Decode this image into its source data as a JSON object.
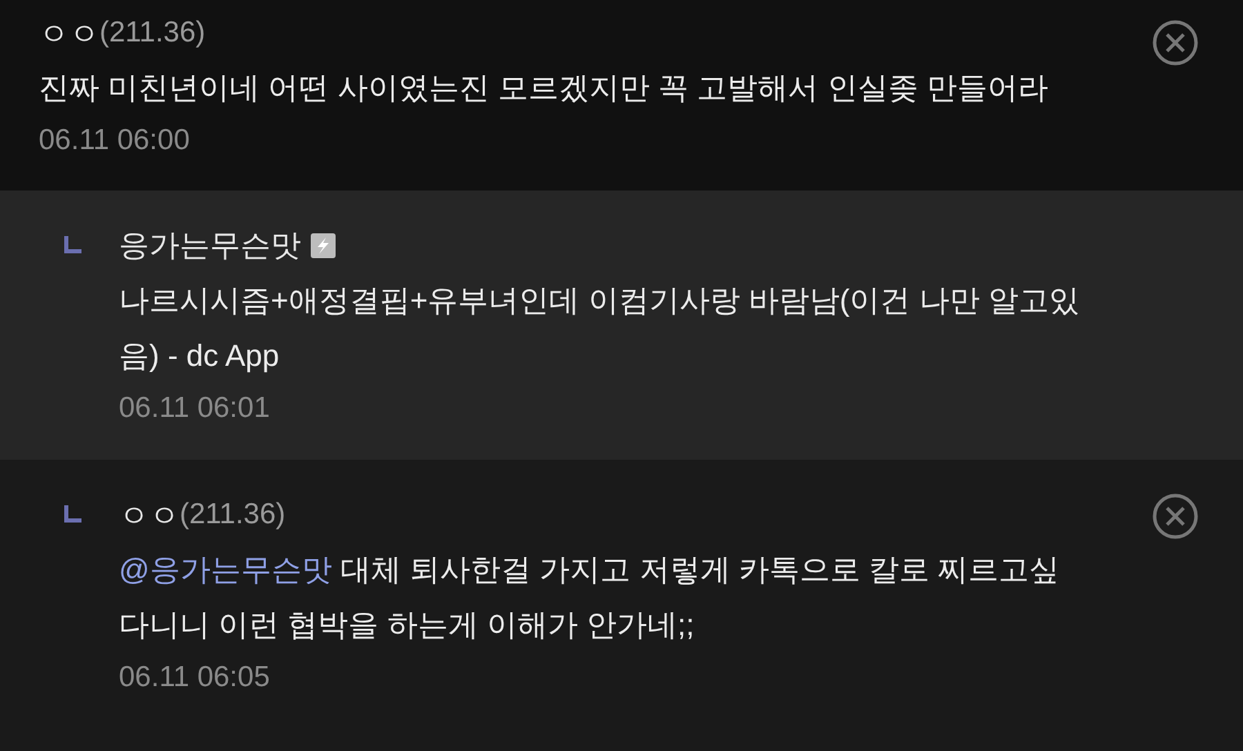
{
  "comments": [
    {
      "kind": "comment",
      "author": "ㅇㅇ",
      "ip": "(211.36)",
      "badge": false,
      "text": "진짜 미친년이네 어떤 사이였는진 모르겠지만 꼭 고발해서 인실좆 만들어라",
      "time": "06.11 06:00",
      "deletable": true
    },
    {
      "kind": "reply",
      "author": "응가는무슨맛",
      "badge": true,
      "text": "나르시시즘+애정결핍+유부녀인데 이컴기사랑 바람남(이건 나만 알고있음) - dc App",
      "time": "06.11 06:01",
      "deletable": false
    },
    {
      "kind": "reply",
      "author": "ㅇㅇ",
      "ip": "(211.36)",
      "badge": false,
      "mention": "@응가는무슨맛",
      "text": "대체 퇴사한걸 가지고 저렇게 카톡으로 칼로 찌르고싶다니니 이런 협박을 하는게 이해가 안가네;;",
      "time": "06.11 06:05",
      "deletable": true
    }
  ]
}
